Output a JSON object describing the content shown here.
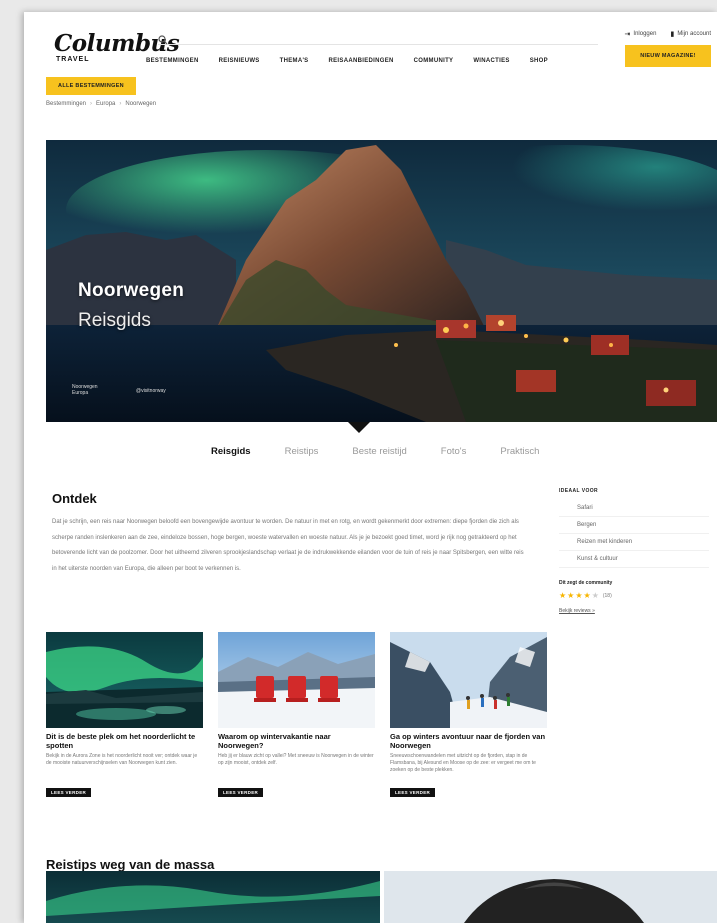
{
  "header": {
    "logo_main": "Columbus",
    "logo_sub": "TRAVEL",
    "search_placeholder": "",
    "login": "Inloggen",
    "account": "Mijn account",
    "nav": [
      "BESTEMMINGEN",
      "REISNIEUWS",
      "THEMA'S",
      "REISAANBIEDINGEN",
      "COMMUNITY",
      "WINACTIES",
      "SHOP"
    ],
    "cta": "NIEUW MAGAZINE!",
    "all_destinations": "ALLE BESTEMMINGEN"
  },
  "breadcrumb": [
    "Bestemmingen",
    "Europa",
    "Noorwegen"
  ],
  "hero": {
    "title": "Noorwegen",
    "subtitle": "Reisgids",
    "credit_left": "Noorwegen Europa",
    "credit_right": "@visitnorway"
  },
  "tabs": [
    {
      "label": "Reisgids",
      "active": true
    },
    {
      "label": "Reistips",
      "active": false
    },
    {
      "label": "Beste reistijd",
      "active": false
    },
    {
      "label": "Foto's",
      "active": false
    },
    {
      "label": "Praktisch",
      "active": false
    }
  ],
  "intro": {
    "title": "Ontdek",
    "text": "Dat je schrijn, een reis naar Noorwegen beloofd een bovengewijde avontuur te worden. De natuur in met en rotg, en wordt gekenmerkt door extremen: diepe fjorden die zich als scherpe randen inslenkeren aan de zee, eindeloze bossen, hoge bergen, woeste watervallen en woeste natuur. Als je je bezoekt goed timet, word je rijk nog getrakteerd op het betoverende licht van de poolzomer. Door het uitheemd zilveren sprookjeslandschap verlaat je de indrukwekkende eilanden voor de tuin of reis je naar Spitsbergen, een witte reis in het uiterste noorden van Europa, die alleen per boot te verkennen is."
  },
  "sidebar": {
    "ideal_head": "IDEAAL VOOR",
    "ideal": [
      "Safari",
      "Bergen",
      "Reizen met kinderen",
      "Kunst & cultuur"
    ],
    "community_head": "Dit zegt de community",
    "rating": 4,
    "rating_max": 5,
    "rating_count": "(18)",
    "review_link": "Bekijk reviews »"
  },
  "cards": [
    {
      "title": "Dit is de beste plek om het noorderlicht te spotten",
      "desc": "Bekijk in de Aurora Zone is het noorderlicht nooit ver; ontdek waar je de mooiste natuurverschijnselen van Noorwegen kunt zien.",
      "btn": "LEES VERDER"
    },
    {
      "title": "Waarom op wintervakantie naar Noorwegen?",
      "desc": "Heb jij er blauw zicht op vallei? Met sneeuw is Noorwegen in de winter op zijn mooist, ontdek zelf.",
      "btn": "LEES VERDER"
    },
    {
      "title": "Ga op winters avontuur naar de fjorden van Noorwegen",
      "desc": "Sneeuwschoenwandelen met uitzicht op de fjorden, stap in de Flamsbana, bij Alesund en Moose op de zee: er vergeet me om te zoeken op de beste plekken.",
      "btn": "LEES VERDER"
    }
  ],
  "section2": {
    "title": "Reistips weg van de massa"
  },
  "colors": {
    "accent": "#f7c21e",
    "dark": "#111111"
  }
}
